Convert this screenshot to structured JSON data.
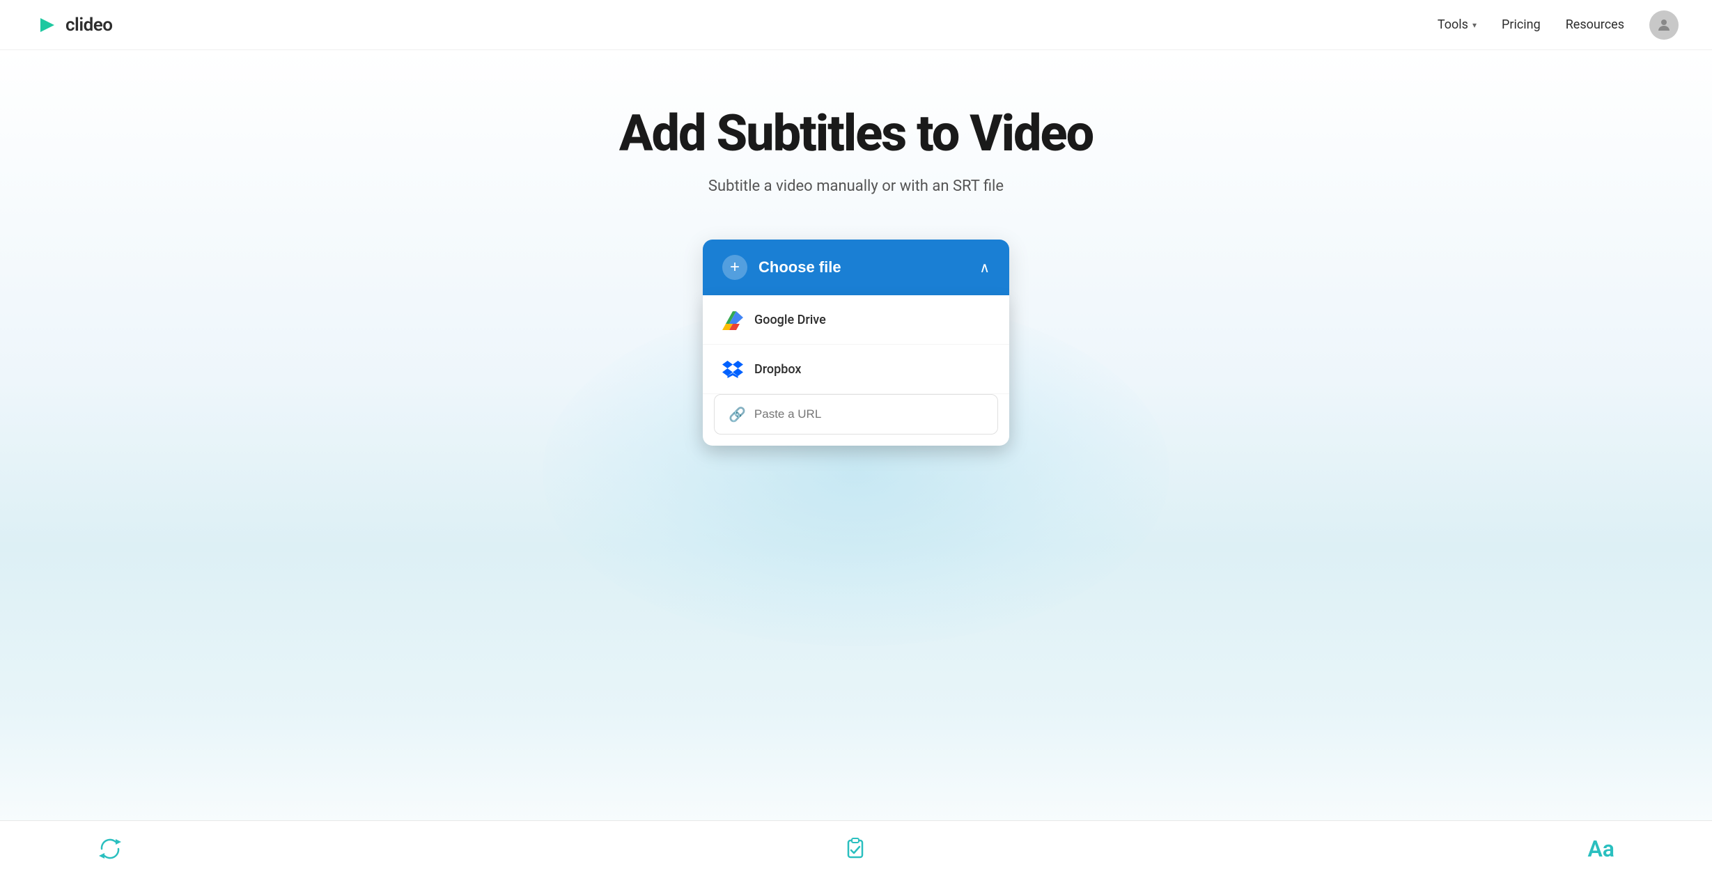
{
  "header": {
    "logo_text": "clideo",
    "nav": {
      "tools_label": "Tools",
      "pricing_label": "Pricing",
      "resources_label": "Resources"
    }
  },
  "main": {
    "page_title": "Add Subtitles to Video",
    "page_subtitle": "Subtitle a video manually or with an SRT file",
    "upload": {
      "choose_file_label": "Choose file",
      "google_drive_label": "Google Drive",
      "dropbox_label": "Dropbox",
      "url_placeholder": "Paste a URL"
    }
  },
  "bottom_bar": {
    "refresh_icon_name": "refresh-icon",
    "clipboard_icon_name": "clipboard-check-icon",
    "font_icon_name": "font-size-icon",
    "font_label": "Aa"
  }
}
